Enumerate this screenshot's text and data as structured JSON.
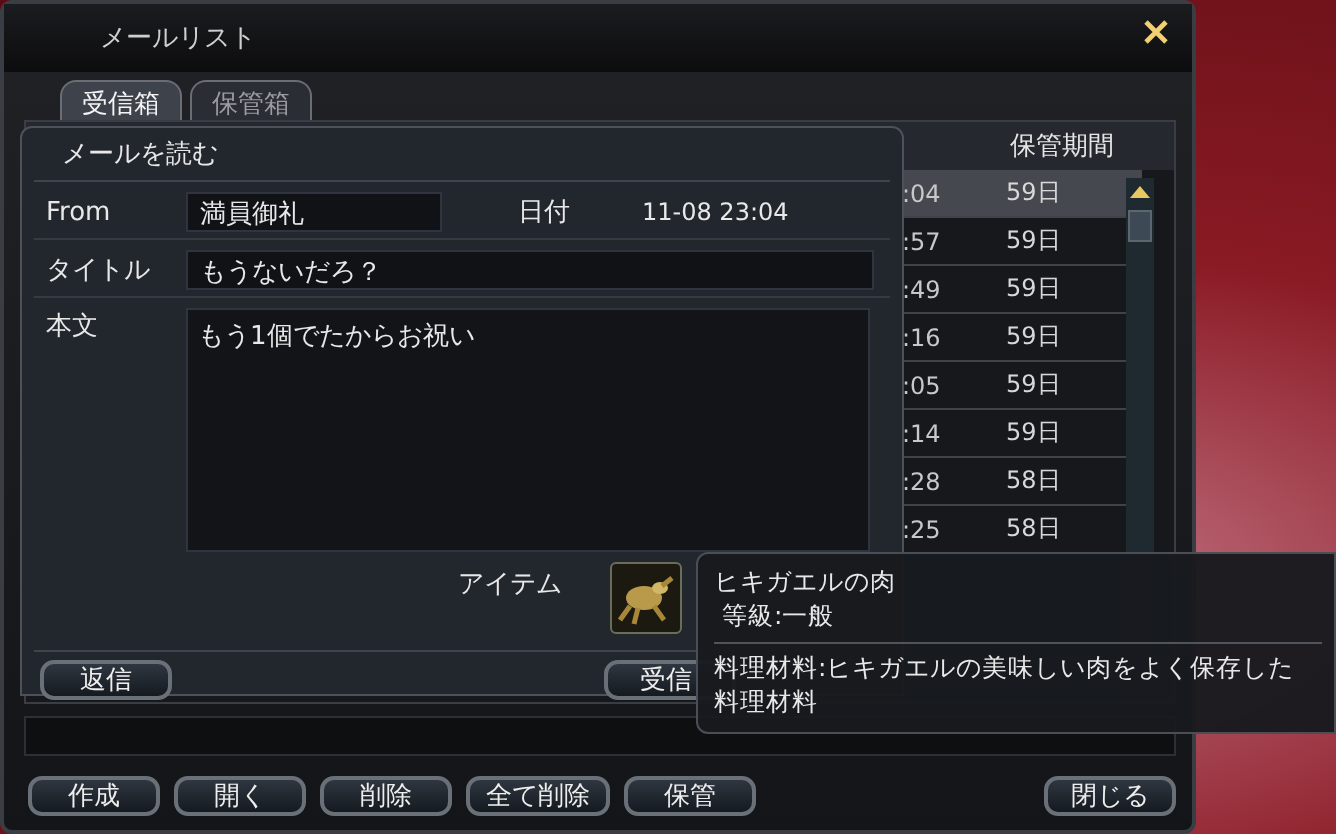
{
  "window": {
    "title": "メールリスト"
  },
  "tabs": [
    {
      "label": "受信箱",
      "selected": true
    },
    {
      "label": "保管箱",
      "selected": false
    }
  ],
  "mail_list": {
    "columns": [
      "保管期間"
    ],
    "rows": [
      {
        "cell_1": ":04",
        "storage_period": "59日",
        "selected": true
      },
      {
        "cell_1": ":57",
        "storage_period": "59日",
        "selected": false
      },
      {
        "cell_1": ":49",
        "storage_period": "59日",
        "selected": false
      },
      {
        "cell_1": ":16",
        "storage_period": "59日",
        "selected": false
      },
      {
        "cell_1": ":05",
        "storage_period": "59日",
        "selected": false
      },
      {
        "cell_1": ":14",
        "storage_period": "59日",
        "selected": false
      },
      {
        "cell_1": ":28",
        "storage_period": "58日",
        "selected": false
      },
      {
        "cell_1": ":25",
        "storage_period": "58日",
        "selected": false
      }
    ]
  },
  "read_mail": {
    "title": "メールを読む",
    "from_label": "From",
    "from": "満員御礼",
    "date_label": "日付",
    "date": "11-08 23:04",
    "subject_label": "タイトル",
    "subject": "もうないだろ？",
    "body_label": "本文",
    "body": "もう1個でたからお祝い",
    "item_label": "アイテム",
    "buttons": [
      "返信",
      "受信"
    ]
  },
  "tooltip": {
    "name": "ヒキガエルの肉",
    "grade": "等級:一般",
    "description_lines": [
      "料理材料:ヒキガエルの美味しい肉をよく保存した",
      "料理材料"
    ]
  },
  "actions": [
    "作成",
    "開く",
    "削除",
    "全て削除",
    "保管"
  ],
  "close_label": "閉じる"
}
